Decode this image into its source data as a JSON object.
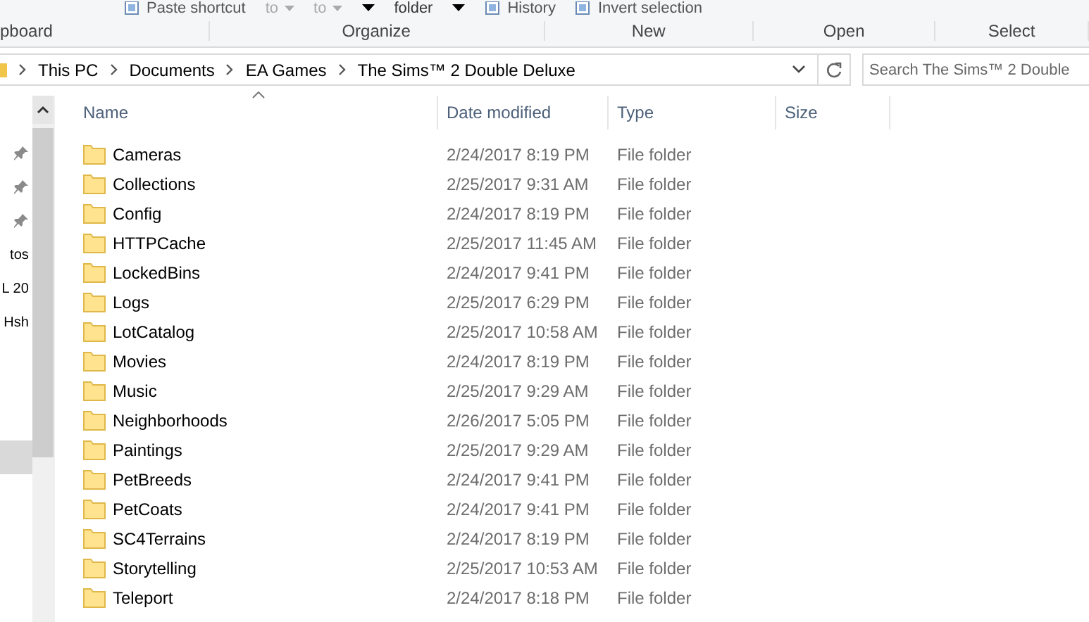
{
  "ribbon": {
    "top_items": [
      {
        "label": "Paste shortcut",
        "kind": "icon"
      },
      {
        "label": "to",
        "kind": "caret"
      },
      {
        "label": "to",
        "kind": "caret"
      },
      {
        "kind": "dropdown"
      },
      {
        "label": "folder",
        "kind": "plain"
      },
      {
        "kind": "dropdown"
      },
      {
        "label": "History",
        "kind": "icon"
      },
      {
        "label": "Invert selection",
        "kind": "icon"
      }
    ],
    "groups": [
      "pboard",
      "Organize",
      "New",
      "Open",
      "Select"
    ]
  },
  "address": {
    "crumbs": [
      "This PC",
      "Documents",
      "EA Games",
      "The Sims™ 2 Double Deluxe"
    ]
  },
  "search": {
    "placeholder": "Search The Sims™ 2 Double"
  },
  "nav": [
    {
      "pinned": true,
      "selected": false
    },
    {
      "pinned": true,
      "selected": false
    },
    {
      "pinned": true,
      "selected": false
    },
    {
      "label": "tos",
      "pinned": false,
      "selected": false
    },
    {
      "label": "L 20",
      "pinned": false,
      "selected": false
    },
    {
      "label": "Hsh",
      "pinned": false,
      "selected": false
    },
    {
      "pinned": false,
      "selected": true
    }
  ],
  "columns": [
    "Name",
    "Date modified",
    "Type",
    "Size"
  ],
  "rows": [
    {
      "name": "Cameras",
      "date": "2/24/2017 8:19 PM",
      "type": "File folder"
    },
    {
      "name": "Collections",
      "date": "2/25/2017 9:31 AM",
      "type": "File folder"
    },
    {
      "name": "Config",
      "date": "2/24/2017 8:19 PM",
      "type": "File folder"
    },
    {
      "name": "HTTPCache",
      "date": "2/25/2017 11:45 AM",
      "type": "File folder"
    },
    {
      "name": "LockedBins",
      "date": "2/24/2017 9:41 PM",
      "type": "File folder"
    },
    {
      "name": "Logs",
      "date": "2/25/2017 6:29 PM",
      "type": "File folder"
    },
    {
      "name": "LotCatalog",
      "date": "2/25/2017 10:58 AM",
      "type": "File folder"
    },
    {
      "name": "Movies",
      "date": "2/24/2017 8:19 PM",
      "type": "File folder"
    },
    {
      "name": "Music",
      "date": "2/25/2017 9:29 AM",
      "type": "File folder"
    },
    {
      "name": "Neighborhoods",
      "date": "2/26/2017 5:05 PM",
      "type": "File folder"
    },
    {
      "name": "Paintings",
      "date": "2/25/2017 9:29 AM",
      "type": "File folder"
    },
    {
      "name": "PetBreeds",
      "date": "2/24/2017 9:41 PM",
      "type": "File folder"
    },
    {
      "name": "PetCoats",
      "date": "2/24/2017 9:41 PM",
      "type": "File folder"
    },
    {
      "name": "SC4Terrains",
      "date": "2/24/2017 8:19 PM",
      "type": "File folder"
    },
    {
      "name": "Storytelling",
      "date": "2/25/2017 10:53 AM",
      "type": "File folder"
    },
    {
      "name": "Teleport",
      "date": "2/24/2017 8:18 PM",
      "type": "File folder"
    }
  ]
}
